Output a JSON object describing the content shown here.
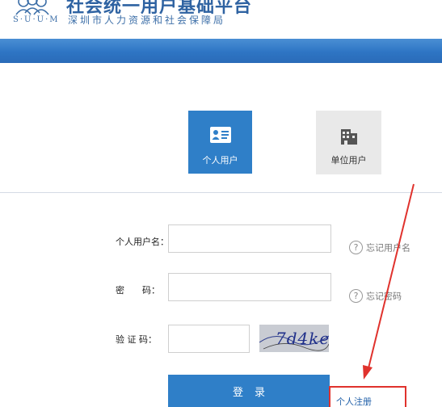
{
  "header": {
    "title": "社会统一用户基础平台",
    "logo_letters": "S·U·U·M",
    "subtitle": "深圳市人力资源和社会保障局"
  },
  "tabs": [
    {
      "label": "个人用户",
      "icon": "id-card-icon",
      "selected": true
    },
    {
      "label": "单位用户",
      "icon": "building-icon",
      "selected": false
    }
  ],
  "form": {
    "username_label": "个人用户名：",
    "password_label": "密　　码：",
    "captcha_label": "验 证 码：",
    "username_value": "",
    "password_value": "",
    "captcha_value": "",
    "captcha_image_text": "7d4ke",
    "forgot_username": "忘记用户名",
    "forgot_password": "忘记密码",
    "login_button": "登录",
    "register_link": "个人注册"
  },
  "colors": {
    "brand_blue": "#2f7fc8",
    "annotation_red": "#e0322d"
  }
}
